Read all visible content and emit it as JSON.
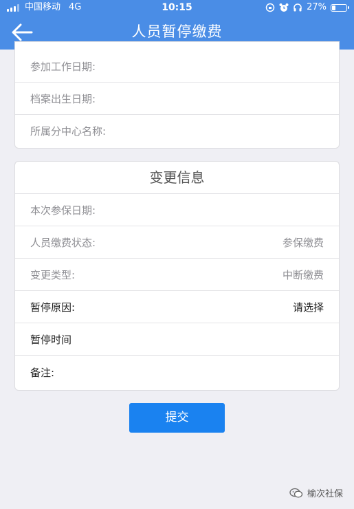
{
  "status_bar": {
    "carrier": "中国移动",
    "network": "4G",
    "time": "10:15",
    "battery": "27%",
    "battery_level": 0.27
  },
  "nav": {
    "title": "人员暂停缴费"
  },
  "personal_info": {
    "rows": [
      {
        "label": "参加工作日期:",
        "value": ""
      },
      {
        "label": "档案出生日期:",
        "value": ""
      },
      {
        "label": "所属分中心名称:",
        "value": ""
      }
    ]
  },
  "change_info": {
    "title": "变更信息",
    "rows": [
      {
        "label": "本次参保日期:",
        "value": ""
      },
      {
        "label": "人员缴费状态:",
        "value": "参保缴费"
      },
      {
        "label": "变更类型:",
        "value": "中断缴费"
      },
      {
        "label": "暂停原因:",
        "value": "请选择"
      },
      {
        "label": "暂停时间",
        "value": ""
      },
      {
        "label": "备注:",
        "value": ""
      }
    ]
  },
  "submit_label": "提交",
  "watermark": "榆次社保",
  "colors": {
    "header": "#4a8de6",
    "button": "#1a82f0",
    "background": "#efeff4"
  }
}
